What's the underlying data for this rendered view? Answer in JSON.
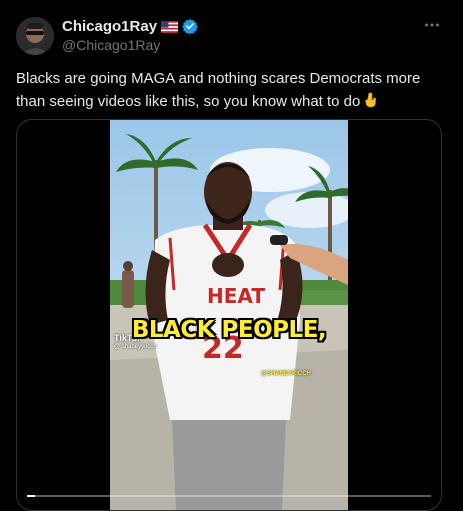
{
  "author": {
    "display_name": "Chicago1Ray",
    "handle": "@Chicago1Ray",
    "flag_icon": "us-flag-icon",
    "verified_icon": "verified-badge-icon",
    "verified_color": "#1d9bf0"
  },
  "tweet": {
    "text": "Blacks are going MAGA and nothing scares Democrats more than seeing videos like this, so you know what to do",
    "emoji_icon": "pointing-down-hand-icon"
  },
  "video": {
    "caption": "BLACK PEOPLE,",
    "tiktok_logo": "TikTok",
    "tiktok_user": "@ shaneyyricch",
    "watermark": "@SHANEYRICCH",
    "jersey_brand": "HEAT",
    "jersey_number": "22",
    "progress": 0.02
  },
  "colors": {
    "background": "#000000",
    "text": "#e7e9ea",
    "secondary": "#71767b",
    "caption": "#ffeb3b"
  }
}
